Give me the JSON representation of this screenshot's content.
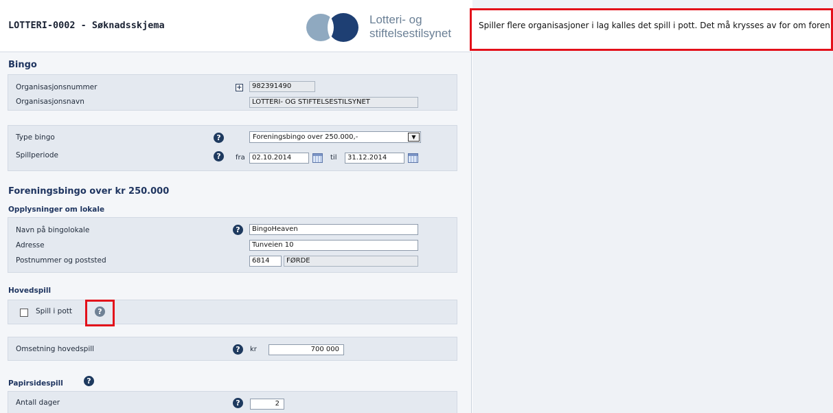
{
  "header": {
    "title": "LOTTERI-0002 - Søknadsskjema",
    "logo_line1": "Lotteri- og",
    "logo_line2": "stiftelsestilsynet"
  },
  "help_text": "Spiller flere organisasjoner i lag kalles det spill i pott. Det må krysses av for om foreningen spiller sammen med andre organisasjoner.",
  "bingo": {
    "heading": "Bingo",
    "org_number_label": "Organisasjonsnummer",
    "org_number_value": "982391490",
    "org_name_label": "Organisasjonsnavn",
    "org_name_value": "LOTTERI-  OG STIFTELSESTILSYNET"
  },
  "type": {
    "type_label": "Type bingo",
    "type_value": "Foreningsbingo over 250.000,-",
    "period_label": "Spillperiode",
    "from_label": "fra",
    "from_value": "02.10.2014",
    "to_label": "til",
    "to_value": "31.12.2014"
  },
  "section": {
    "heading": "Foreningsbingo over kr 250.000",
    "subheading": "Opplysninger om lokale"
  },
  "venue": {
    "name_label": "Navn på bingolokale",
    "name_value": "BingoHeaven",
    "address_label": "Adresse",
    "address_value": "Tunveien 10",
    "postal_label": "Postnummer og poststed",
    "postal_code": "6814",
    "postal_place": "FØRDE"
  },
  "main_game": {
    "heading": "Hovedspill",
    "pot_label": "Spill i pott",
    "pot_checked": false,
    "turnover_label": "Omsetning hovedspill",
    "currency": "kr",
    "turnover_value": "700 000"
  },
  "paper": {
    "heading": "Papirsidespill",
    "days_label": "Antall dager",
    "days_value": "2"
  },
  "help_glyph": "?",
  "colors": {
    "highlight": "#e3101a",
    "heading": "#1f3560",
    "panel": "#e4e9f0",
    "help_icon": "#1e3a5f"
  }
}
